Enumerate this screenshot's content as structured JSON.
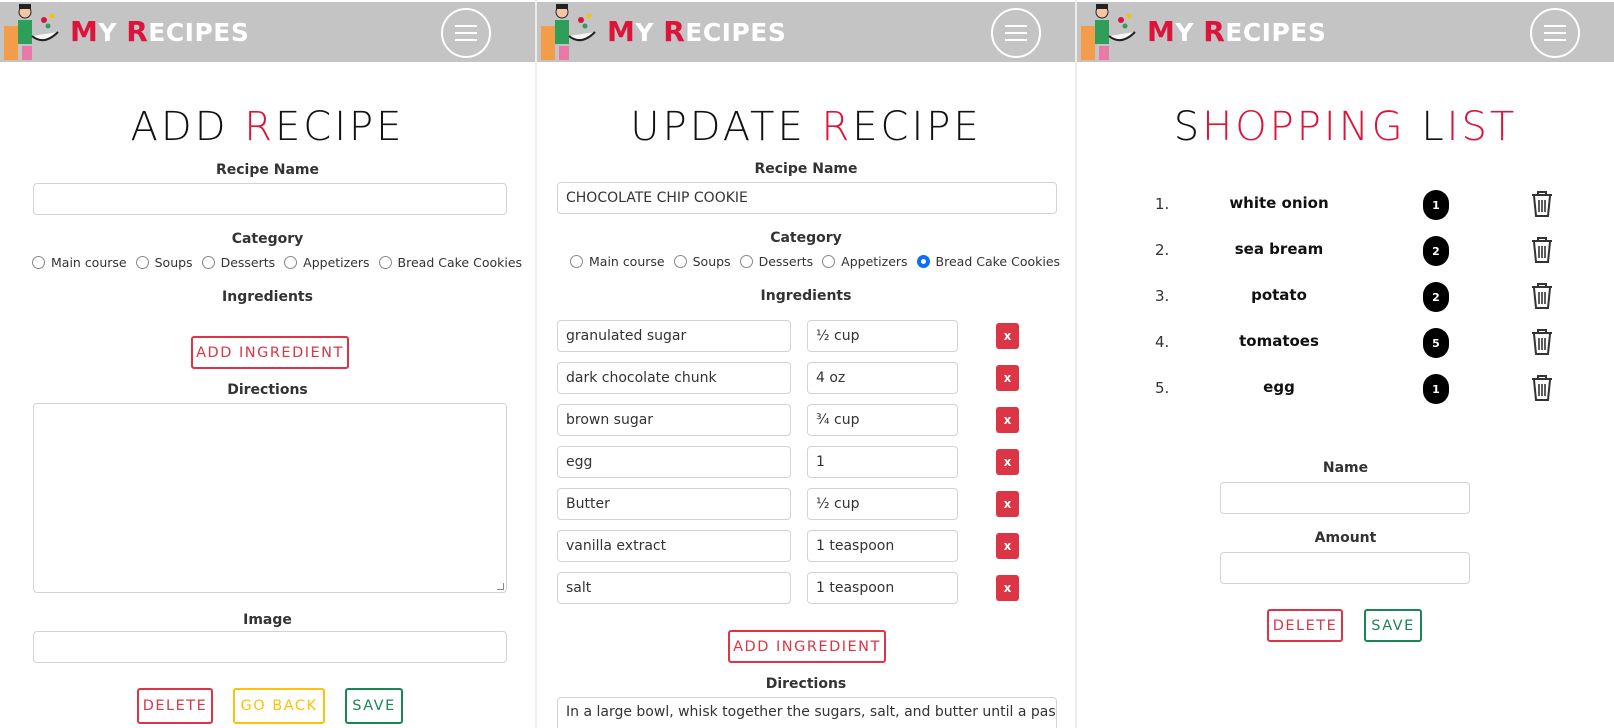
{
  "brand": {
    "first_m": "M",
    "y_part": "Y ",
    "r": "R",
    "rest": "ECIPES"
  },
  "icons": {
    "menu": "hamburger-menu-icon",
    "logo": "chef-logo-icon",
    "trash": "trash-icon"
  },
  "colors": {
    "accent": "#dc143c",
    "navbar": "#c4c4c4",
    "danger": "#dc3545",
    "warning": "#ffc107",
    "success": "#198754",
    "radio_selected": "#0d6efd"
  },
  "add_recipe": {
    "title_a": "ADD ",
    "title_r": "R",
    "title_b": "ECIPE",
    "recipe_name_label": "Recipe Name",
    "recipe_name_value": "",
    "category_label": "Category",
    "categories": [
      {
        "label": "Main course",
        "checked": false
      },
      {
        "label": "Soups",
        "checked": false
      },
      {
        "label": "Desserts",
        "checked": false
      },
      {
        "label": "Appetizers",
        "checked": false
      },
      {
        "label": "Bread Cake Cookies",
        "checked": false
      }
    ],
    "ingredients_label": "Ingredients",
    "add_ingredient": "ADD INGREDIENT",
    "directions_label": "Directions",
    "image_label": "Image",
    "delete": "DELETE",
    "go_back": "GO BACK",
    "save": "SAVE"
  },
  "update_recipe": {
    "title_a": "UPDATE ",
    "title_r": "R",
    "title_b": "ECIPE",
    "recipe_name_label": "Recipe Name",
    "recipe_name_value": "CHOCOLATE CHIP COOKIE",
    "category_label": "Category",
    "categories": [
      {
        "label": "Main course",
        "checked": false
      },
      {
        "label": "Soups",
        "checked": false
      },
      {
        "label": "Desserts",
        "checked": false
      },
      {
        "label": "Appetizers",
        "checked": false
      },
      {
        "label": "Bread Cake Cookies",
        "checked": true
      }
    ],
    "ingredients_label": "Ingredients",
    "ingredients": [
      {
        "name": "granulated sugar",
        "amount": "½ cup"
      },
      {
        "name": "dark chocolate chunk",
        "amount": "4 oz"
      },
      {
        "name": "brown sugar",
        "amount": "¾ cup"
      },
      {
        "name": "egg",
        "amount": "1"
      },
      {
        "name": "Butter",
        "amount": "½ cup"
      },
      {
        "name": "vanilla extract",
        "amount": "1 teaspoon"
      },
      {
        "name": "salt",
        "amount": "1 teaspoon"
      }
    ],
    "remove_label": "x",
    "add_ingredient": "ADD INGREDIENT",
    "directions_label": "Directions",
    "directions_value": "In a large bowl, whisk together the sugars, salt, and butter until a paste"
  },
  "shopping_list": {
    "title_s": "S",
    "title_hopping": "HOPPING ",
    "title_l": "L",
    "title_ist": "IST",
    "items": [
      {
        "num": "1.",
        "name": "white onion",
        "count": "1"
      },
      {
        "num": "2.",
        "name": "sea bream",
        "count": "2"
      },
      {
        "num": "3.",
        "name": "potato",
        "count": "2"
      },
      {
        "num": "4.",
        "name": "tomatoes",
        "count": "5"
      },
      {
        "num": "5.",
        "name": "egg",
        "count": "1"
      }
    ],
    "name_label": "Name",
    "amount_label": "Amount",
    "delete": "DELETE",
    "save": "SAVE"
  }
}
